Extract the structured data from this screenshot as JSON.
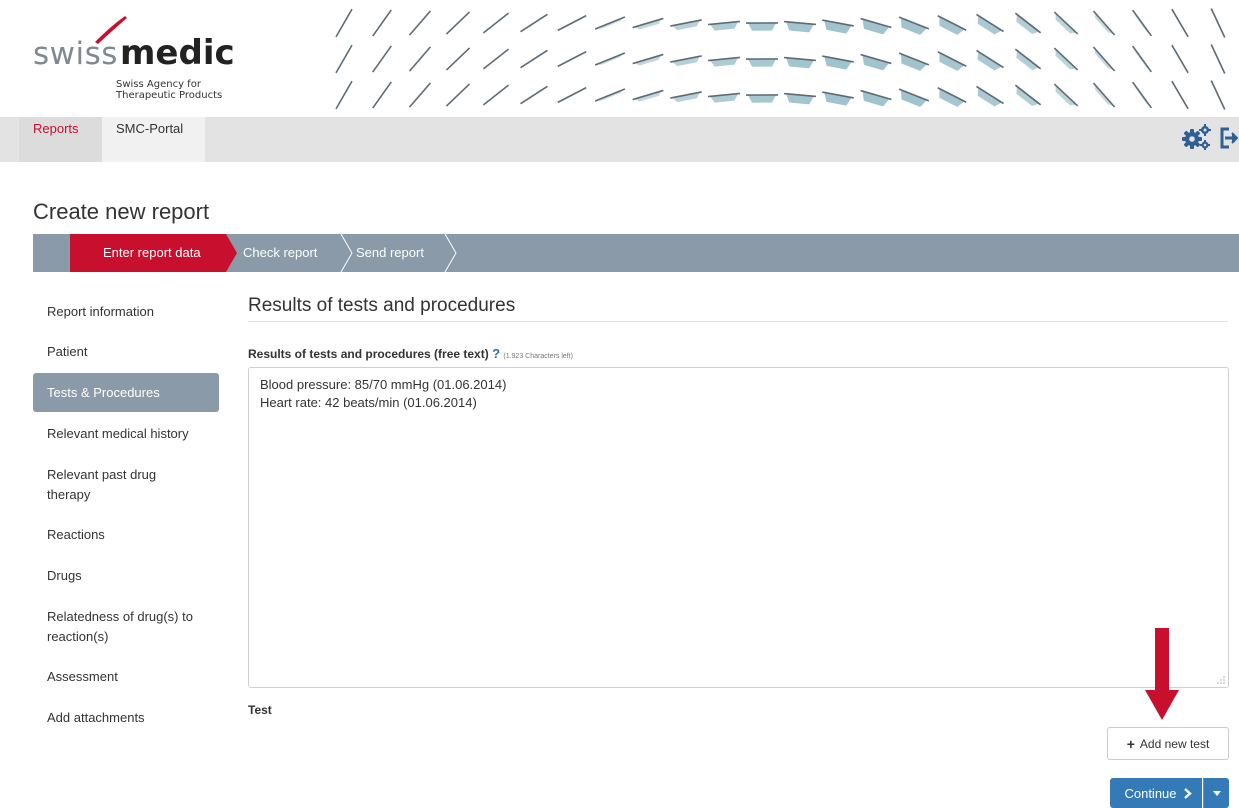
{
  "logo": {
    "swiss": "swiss",
    "medic": "medic",
    "tagline_line1": "Swiss Agency for",
    "tagline_line2": "Therapeutic Products"
  },
  "nav": {
    "tabs": [
      {
        "label": "Reports",
        "active": true
      },
      {
        "label": "SMC-Portal",
        "active": false
      }
    ],
    "icons": [
      "settings-gears-icon",
      "logout-icon"
    ]
  },
  "page": {
    "title": "Create new report"
  },
  "stepper": {
    "steps": [
      {
        "label": "Enter report data",
        "active": true
      },
      {
        "label": "Check report",
        "active": false
      },
      {
        "label": "Send report",
        "active": false
      }
    ]
  },
  "sidebar": {
    "items": [
      {
        "label": "Report information",
        "active": false
      },
      {
        "label": "Patient",
        "active": false
      },
      {
        "label": "Tests & Procedures",
        "active": true
      },
      {
        "label": "Relevant medical history",
        "active": false
      },
      {
        "label": "Relevant past drug therapy",
        "active": false
      },
      {
        "label": "Reactions",
        "active": false
      },
      {
        "label": "Drugs",
        "active": false
      },
      {
        "label": "Relatedness of drug(s) to reaction(s)",
        "active": false
      },
      {
        "label": "Assessment",
        "active": false
      },
      {
        "label": "Add attachments",
        "active": false
      }
    ]
  },
  "main": {
    "section_title": "Results of tests and procedures",
    "field_label": "Results of tests and procedures (free text)",
    "help_symbol": "?",
    "chars_left": "(1.923 Characters left)",
    "textarea_lines": [
      "Blood pressure: 85/70 mmHg (01.06.2014)",
      "Heart rate: 42 beats/min (01.06.2014)"
    ],
    "test_label": "Test",
    "add_test_label": "Add new test",
    "continue_label": "Continue"
  },
  "colors": {
    "brand_red": "#c8102e",
    "stepper_gray": "#8b9aa8",
    "primary_blue": "#337ab7",
    "annotation_arrow": "#c8102e"
  }
}
